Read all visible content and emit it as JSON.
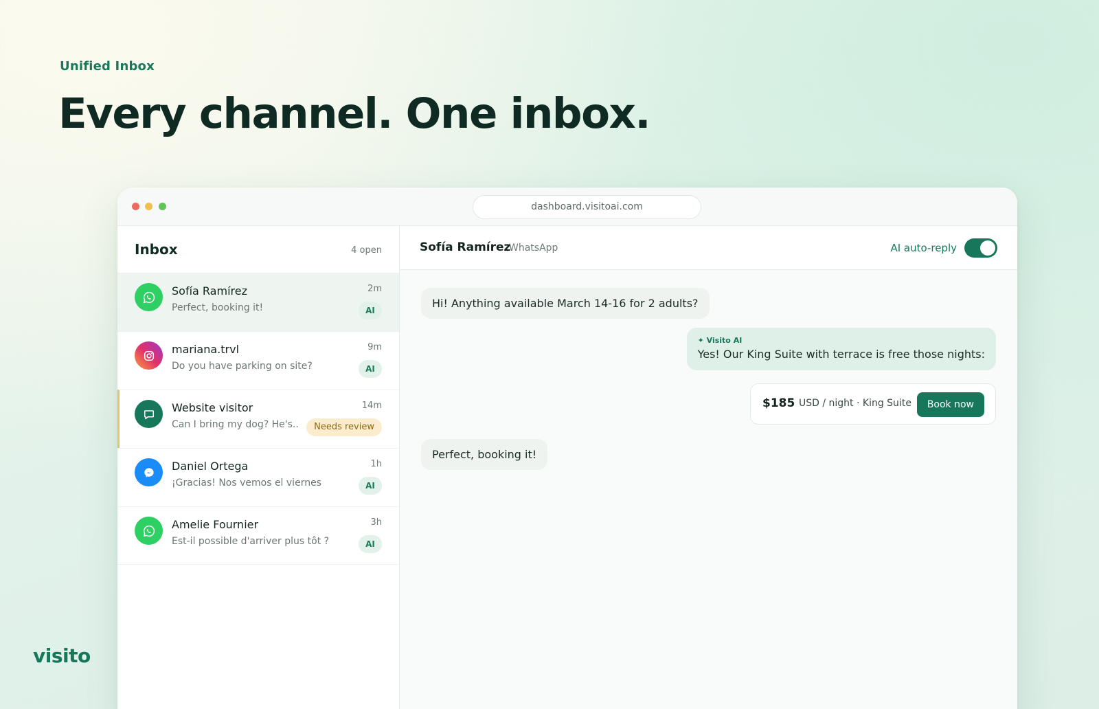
{
  "hero": {
    "eyebrow": "Unified Inbox",
    "headline": "Every channel. One inbox."
  },
  "brand": {
    "name": "visito"
  },
  "window": {
    "url": "dashboard.visitoai.com"
  },
  "inbox": {
    "title": "Inbox",
    "count": "4 open",
    "conversations": [
      {
        "name": "Sofía Ramírez",
        "snippet": "Perfect, booking it!",
        "time": "2m",
        "badge": "AI",
        "channel_icon": "whatsapp-icon",
        "active": true
      },
      {
        "name": "mariana.trvl",
        "snippet": "Do you have parking on site?",
        "time": "9m",
        "badge": "AI",
        "channel_icon": "instagram-icon"
      },
      {
        "name": "Website visitor",
        "snippet": "Can I bring my dog? He's...",
        "time": "14m",
        "badge": "Needs review",
        "channel_icon": "chat-bubble-icon"
      },
      {
        "name": "Daniel Ortega",
        "snippet": "¡Gracias! Nos vemos el viernes",
        "time": "1h",
        "badge": "AI",
        "channel_icon": "messenger-icon"
      },
      {
        "name": "Amelie Fournier",
        "snippet": "Est-il possible d'arriver plus tôt ?",
        "time": "3h",
        "badge": "AI",
        "channel_icon": "whatsapp-icon"
      }
    ]
  },
  "chat": {
    "contact_name": "Sofía Ramírez",
    "channel": "WhatsApp",
    "auto_reply_label": "AI auto-reply",
    "auto_reply_on": true,
    "messages": {
      "incoming_1": "Hi! Anything available March 14-16 for 2 adults?",
      "ai_tag": "✦ Visito AI",
      "ai_reply": "Yes! Our King Suite with terrace is free those nights:",
      "incoming_2": "Perfect, booking it!"
    },
    "offer": {
      "price": "$185",
      "detail": "USD / night · King Suite",
      "button": "Book now"
    }
  },
  "colors": {
    "brand_green": "#17775a",
    "review_accent": "#e5c16a"
  }
}
